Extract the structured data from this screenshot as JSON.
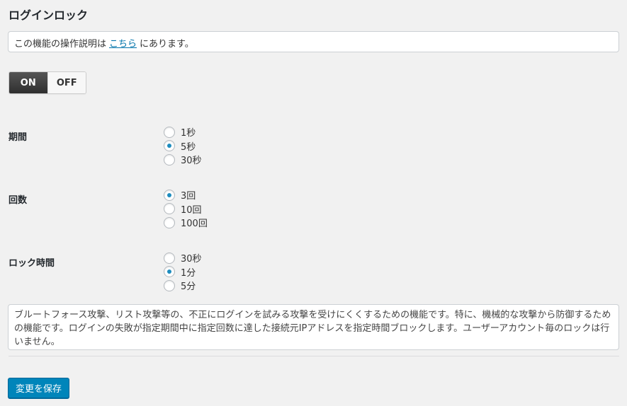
{
  "page": {
    "title": "ログインロック"
  },
  "notice": {
    "before": "この機能の操作説明は",
    "link": "こちら",
    "after": "にあります。"
  },
  "toggle": {
    "on_label": "ON",
    "off_label": "OFF",
    "selected": "ON"
  },
  "fields": [
    {
      "label": "期間",
      "options": [
        "1秒",
        "5秒",
        "30秒"
      ],
      "selected": 1
    },
    {
      "label": "回数",
      "options": [
        "3回",
        "10回",
        "100回"
      ],
      "selected": 0
    },
    {
      "label": "ロック時間",
      "options": [
        "30秒",
        "1分",
        "5分"
      ],
      "selected": 1
    }
  ],
  "description": "ブルートフォース攻撃、リスト攻撃等の、不正にログインを試みる攻撃を受けにくくするための機能です。特に、機械的な攻撃から防御するための機能です。ログインの失敗が指定期間中に指定回数に達した接続元IPアドレスを指定時間ブロックします。ユーザーアカウント毎のロックは行いません。",
  "save_button": {
    "label": "変更を保存"
  },
  "colors": {
    "accent": "#0085ba",
    "radio_checked": "#1e8cbe",
    "link": "#0073aa"
  }
}
